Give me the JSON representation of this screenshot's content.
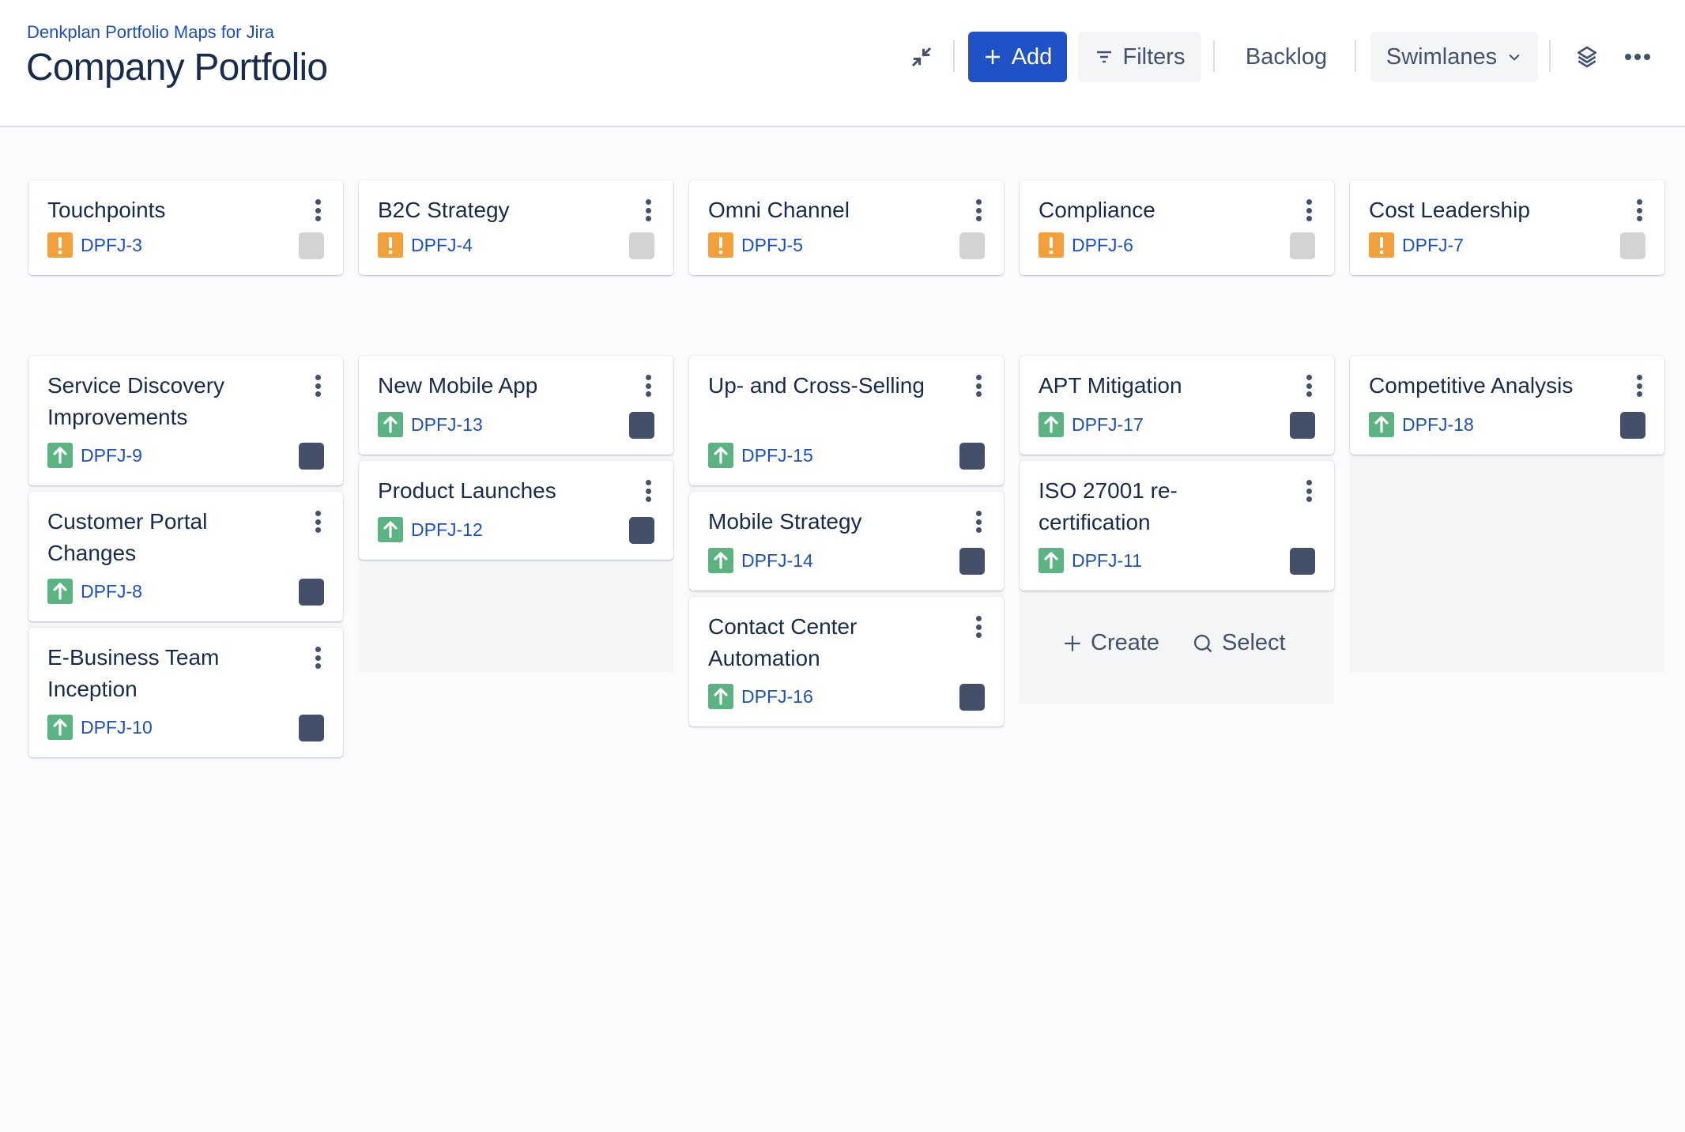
{
  "header": {
    "app_name": "Denkplan Portfolio Maps for Jira",
    "title": "Company Portfolio"
  },
  "toolbar": {
    "collapse_icon": "collapse-arrows-icon",
    "add_label": "Add",
    "filters_label": "Filters",
    "backlog_label": "Backlog",
    "swimlanes_label": "Swimlanes",
    "layers_icon": "layers-icon",
    "more_icon": "more-horizontal-icon"
  },
  "colors": {
    "accent": "#1f52c6",
    "link": "#1d4fc4",
    "priority_high": "#f2a03b",
    "priority_up": "#5cb382",
    "status_todo": "#d3d3d3",
    "status_dark": "#44506a",
    "column_bg": "#f4f5f7"
  },
  "board": {
    "columns": [
      {
        "top_card": {
          "title": "Touchpoints",
          "key": "DPFJ-3",
          "priority": "high",
          "status": "light"
        },
        "cards": [
          {
            "title": "Service Discovery Improvements",
            "key": "DPFJ-9",
            "priority": "up",
            "status": "dark"
          },
          {
            "title": "Customer Portal Changes",
            "key": "DPFJ-8",
            "priority": "up",
            "status": "dark"
          },
          {
            "title": "E-Business Team Inception",
            "key": "DPFJ-10",
            "priority": "up",
            "status": "dark"
          }
        ]
      },
      {
        "top_card": {
          "title": "B2C Strategy",
          "key": "DPFJ-4",
          "priority": "high",
          "status": "light"
        },
        "cards": [
          {
            "title": "New Mobile App",
            "key": "DPFJ-13",
            "priority": "up",
            "status": "dark"
          },
          {
            "title": "Product Launches",
            "key": "DPFJ-12",
            "priority": "up",
            "status": "dark"
          }
        ]
      },
      {
        "top_card": {
          "title": "Omni Channel",
          "key": "DPFJ-5",
          "priority": "high",
          "status": "light"
        },
        "cards": [
          {
            "title": "Up- and Cross-Selling",
            "key": "DPFJ-15",
            "priority": "up",
            "status": "dark"
          },
          {
            "title": "Mobile Strategy",
            "key": "DPFJ-14",
            "priority": "up",
            "status": "dark"
          },
          {
            "title": "Contact Center Automation",
            "key": "DPFJ-16",
            "priority": "up",
            "status": "dark"
          }
        ]
      },
      {
        "top_card": {
          "title": "Compliance",
          "key": "DPFJ-6",
          "priority": "high",
          "status": "light"
        },
        "cards": [
          {
            "title": "APT Mitigation",
            "key": "DPFJ-17",
            "priority": "up",
            "status": "dark"
          },
          {
            "title": "ISO 27001 re-certification",
            "key": "DPFJ-11",
            "priority": "up",
            "status": "dark"
          }
        ],
        "actions": {
          "create_label": "Create",
          "select_label": "Select"
        }
      },
      {
        "top_card": {
          "title": "Cost Leadership",
          "key": "DPFJ-7",
          "priority": "high",
          "status": "light"
        },
        "cards": [
          {
            "title": "Competitive Analysis",
            "key": "DPFJ-18",
            "priority": "up",
            "status": "dark"
          }
        ]
      }
    ]
  }
}
